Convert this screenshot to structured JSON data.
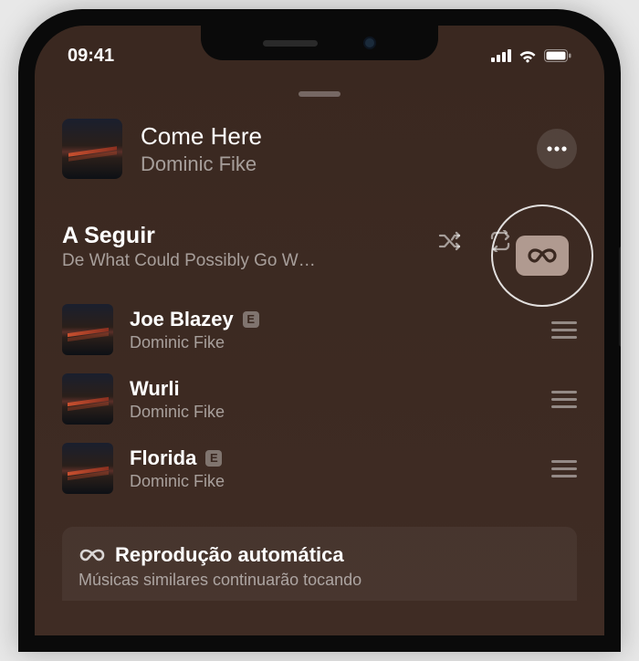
{
  "status": {
    "time": "09:41"
  },
  "now_playing": {
    "title": "Come Here",
    "artist": "Dominic Fike"
  },
  "queue": {
    "title": "A Seguir",
    "subtitle": "De What Could Possibly Go W…",
    "tracks": [
      {
        "title": "Joe Blazey",
        "artist": "Dominic Fike",
        "explicit": true
      },
      {
        "title": "Wurli",
        "artist": "Dominic Fike",
        "explicit": false
      },
      {
        "title": "Florida",
        "artist": "Dominic Fike",
        "explicit": true
      }
    ]
  },
  "autoplay": {
    "title": "Reprodução automática",
    "subtitle": "Músicas similares continuarão tocando"
  },
  "badges": {
    "explicit": "E"
  }
}
